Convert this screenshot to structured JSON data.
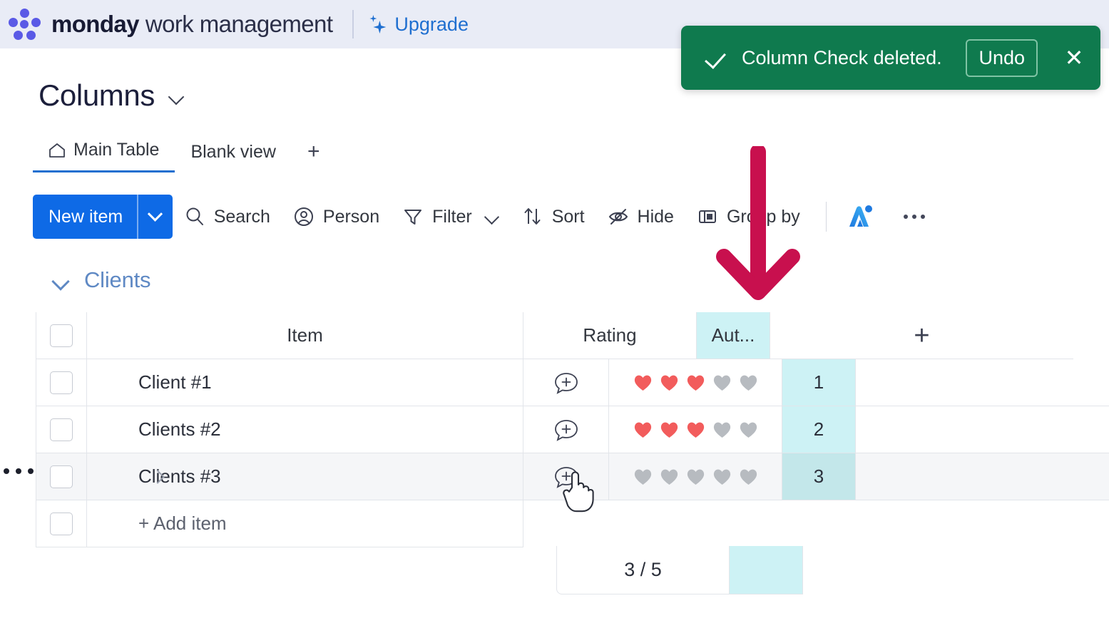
{
  "topbar": {
    "brand_bold": "monday",
    "brand_light": "work management",
    "upgrade_label": "Upgrade",
    "logo_icon": "monday-dots-logo",
    "sparkle_icon": "sparkle-icon",
    "background_color": "#e9ecf6",
    "accent_color": "#1f6fd0"
  },
  "toast": {
    "message": "Column Check deleted.",
    "undo_label": "Undo",
    "close_icon": "close-icon",
    "check_icon": "check-icon",
    "background_color": "#0f7a4e"
  },
  "page": {
    "title": "Columns",
    "title_caret_icon": "chevron-down-icon"
  },
  "tabs": {
    "items": [
      {
        "label": "Main Table",
        "icon": "home-icon",
        "active": true
      },
      {
        "label": "Blank view",
        "icon": "",
        "active": false
      }
    ],
    "add_label": "+",
    "active_underline_color": "#1f6fd0"
  },
  "toolbar": {
    "new_item_label": "New item",
    "new_item_color": "#0e6ae6",
    "new_item_caret_icon": "chevron-down-icon",
    "items": [
      {
        "label": "Search",
        "icon": "search-icon",
        "caret": false
      },
      {
        "label": "Person",
        "icon": "person-icon",
        "caret": false
      },
      {
        "label": "Filter",
        "icon": "filter-icon",
        "caret": true
      },
      {
        "label": "Sort",
        "icon": "sort-icon",
        "caret": false
      },
      {
        "label": "Hide",
        "icon": "hide-eye-icon",
        "caret": false
      },
      {
        "label": "Group by",
        "icon": "group-by-icon",
        "caret": false
      }
    ],
    "ai_icon": "monday-ai-icon",
    "more_icon": "more-options-icon"
  },
  "group": {
    "name": "Clients",
    "collapse_icon": "chevron-down-icon",
    "color": "#589bdc"
  },
  "table": {
    "columns": [
      {
        "key": "checkbox",
        "label": ""
      },
      {
        "key": "item",
        "label": "Item"
      },
      {
        "key": "conversation",
        "label": ""
      },
      {
        "key": "rating",
        "label": "Rating"
      },
      {
        "key": "aut",
        "label": "Aut...",
        "highlight_color": "#cdf2f5"
      },
      {
        "key": "add",
        "label": "+"
      }
    ],
    "rows": [
      {
        "name": "Client #1",
        "rating_filled": 3,
        "rating_total": 5,
        "aut": "1",
        "hovered": false,
        "expandable": false
      },
      {
        "name": "Clients #2",
        "rating_filled": 3,
        "rating_total": 5,
        "aut": "2",
        "hovered": false,
        "expandable": false
      },
      {
        "name": "Clients #3",
        "rating_filled": 0,
        "rating_total": 5,
        "aut": "3",
        "hovered": true,
        "expandable": true
      }
    ],
    "add_item_label": "+ Add item",
    "summary": {
      "rating": "3 / 5"
    },
    "heart_filled_color": "#f25c5c",
    "heart_empty_color": "#b7bbc0"
  },
  "annotation": {
    "arrow_icon": "down-arrow-annotation",
    "arrow_color": "#c8104e"
  },
  "cursor": {
    "icon": "pointing-hand-cursor"
  },
  "row_handle": {
    "icon": "drag-dots-icon"
  }
}
